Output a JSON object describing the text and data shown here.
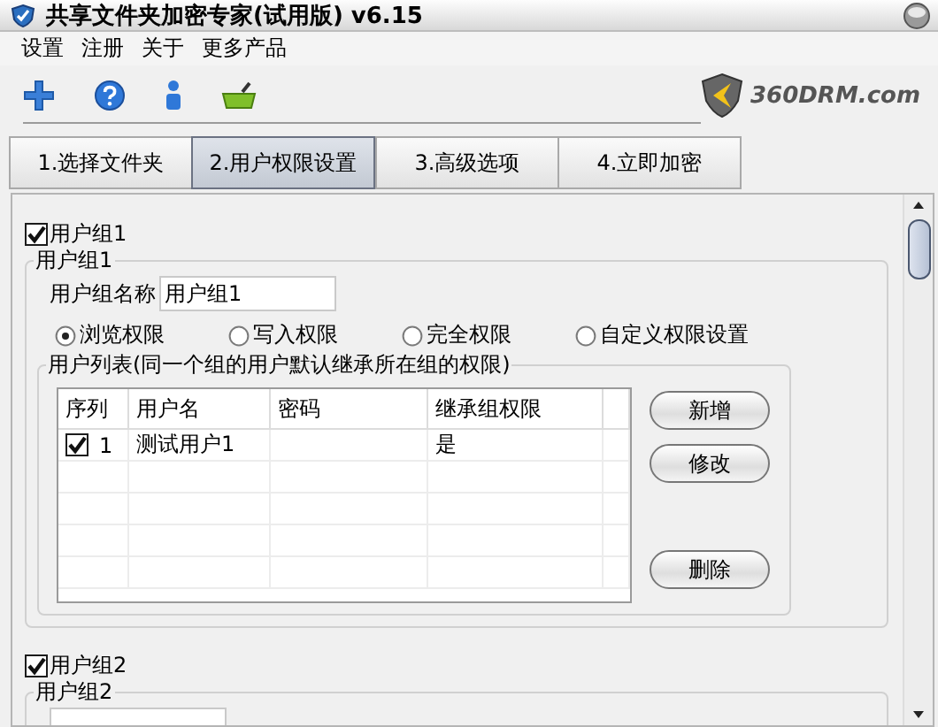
{
  "window": {
    "title": "共享文件夹加密专家(试用版) v6.15"
  },
  "menu": [
    "设置",
    "注册",
    "关于",
    "更多产品"
  ],
  "logo": {
    "text": "360DRM.com"
  },
  "tabs": [
    {
      "label": "1.选择文件夹",
      "selected": false
    },
    {
      "label": "2.用户权限设置",
      "selected": true
    },
    {
      "label": "3.高级选项",
      "selected": false
    },
    {
      "label": "4.立即加密",
      "selected": false
    }
  ],
  "groups": [
    {
      "label": "用户组1",
      "checked": true,
      "legend": "用户组1",
      "name_label": "用户组名称",
      "name_value": "用户组1",
      "permissions": [
        {
          "label": "浏览权限",
          "selected": true
        },
        {
          "label": "写入权限",
          "selected": false
        },
        {
          "label": "完全权限",
          "selected": false
        },
        {
          "label": "自定义权限设置",
          "selected": false
        }
      ],
      "user_list": {
        "legend": "用户列表(同一个组的用户默认继承所在组的权限)",
        "columns": [
          "序列",
          "用户名",
          "密码",
          "继承组权限"
        ],
        "rows": [
          {
            "checked": true,
            "index": "1",
            "username": "测试用户1",
            "inherit": "是"
          }
        ],
        "buttons": [
          "新增",
          "修改",
          "删除"
        ]
      }
    },
    {
      "label": "用户组2",
      "checked": true,
      "legend": "用户组2"
    }
  ]
}
